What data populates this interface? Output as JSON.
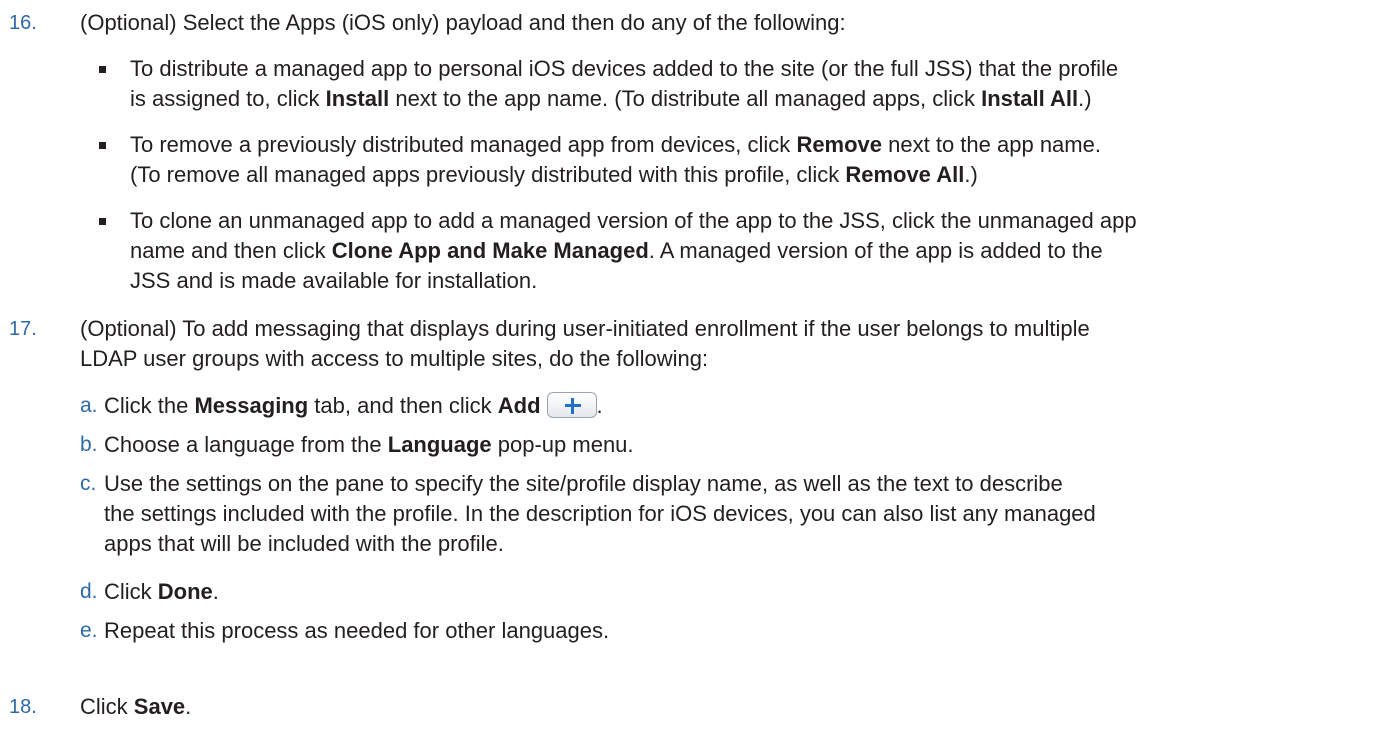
{
  "steps": [
    {
      "number": "16.",
      "text": "(Optional) Select the Apps (iOS only) payload and then do any of the following:",
      "bullets": [
        {
          "line1_pre": "To distribute a managed app to personal iOS devices added to the site (or the full JSS) that the profile",
          "line2_pre": "is assigned to, click ",
          "bold1": "Install",
          "mid": " next to the app name. (To distribute all managed apps, click ",
          "bold2": "Install All",
          "end": ".)"
        },
        {
          "pre": "To remove a previously distributed managed app from devices, click ",
          "bold1": "Remove",
          "mid": " next to the app name.",
          "line2_pre": "(To remove all managed apps previously distributed with this profile, click ",
          "bold2": "Remove All",
          "end": ".)"
        },
        {
          "line1": "To clone an unmanaged app to add a managed version of the app to the JSS, click the unmanaged app",
          "line2_pre": "name and then click ",
          "bold1": "Clone App and Make Managed",
          "line2_post": ". A managed version of the app is added to the",
          "line3": "JSS and is made available for installation."
        }
      ]
    },
    {
      "number": "17.",
      "line1": "(Optional) To add messaging that displays during user-initiated enrollment if the user belongs to multiple",
      "line2": "LDAP user groups with access to multiple sites, do the following:",
      "substeps": [
        {
          "letter": "a.",
          "pre": "Click the ",
          "bold1": "Messaging",
          "mid": " tab, and then click ",
          "bold2": "Add",
          "end": "."
        },
        {
          "letter": "b.",
          "pre": "Choose a language from the ",
          "bold1": "Language",
          "end": " pop-up menu."
        },
        {
          "letter": "c.",
          "line1": "Use the settings on the pane to specify the site/profile display name, as well as the text to describe",
          "line2": "the settings included with the profile. In the description for iOS devices, you can also list any managed",
          "line3": "apps that will be included with the profile."
        },
        {
          "letter": "d.",
          "pre": "Click ",
          "bold1": "Done",
          "end": "."
        },
        {
          "letter": "e.",
          "text": "Repeat this process as needed for other languages."
        }
      ]
    },
    {
      "number": "18.",
      "pre": "Click ",
      "bold1": "Save",
      "end": "."
    }
  ],
  "icons": {
    "add_button": "plus-icon"
  },
  "colors": {
    "accent_numbers": "#2e6aa8",
    "body_text": "#231f20",
    "plus_icon": "#1f6fc4"
  }
}
